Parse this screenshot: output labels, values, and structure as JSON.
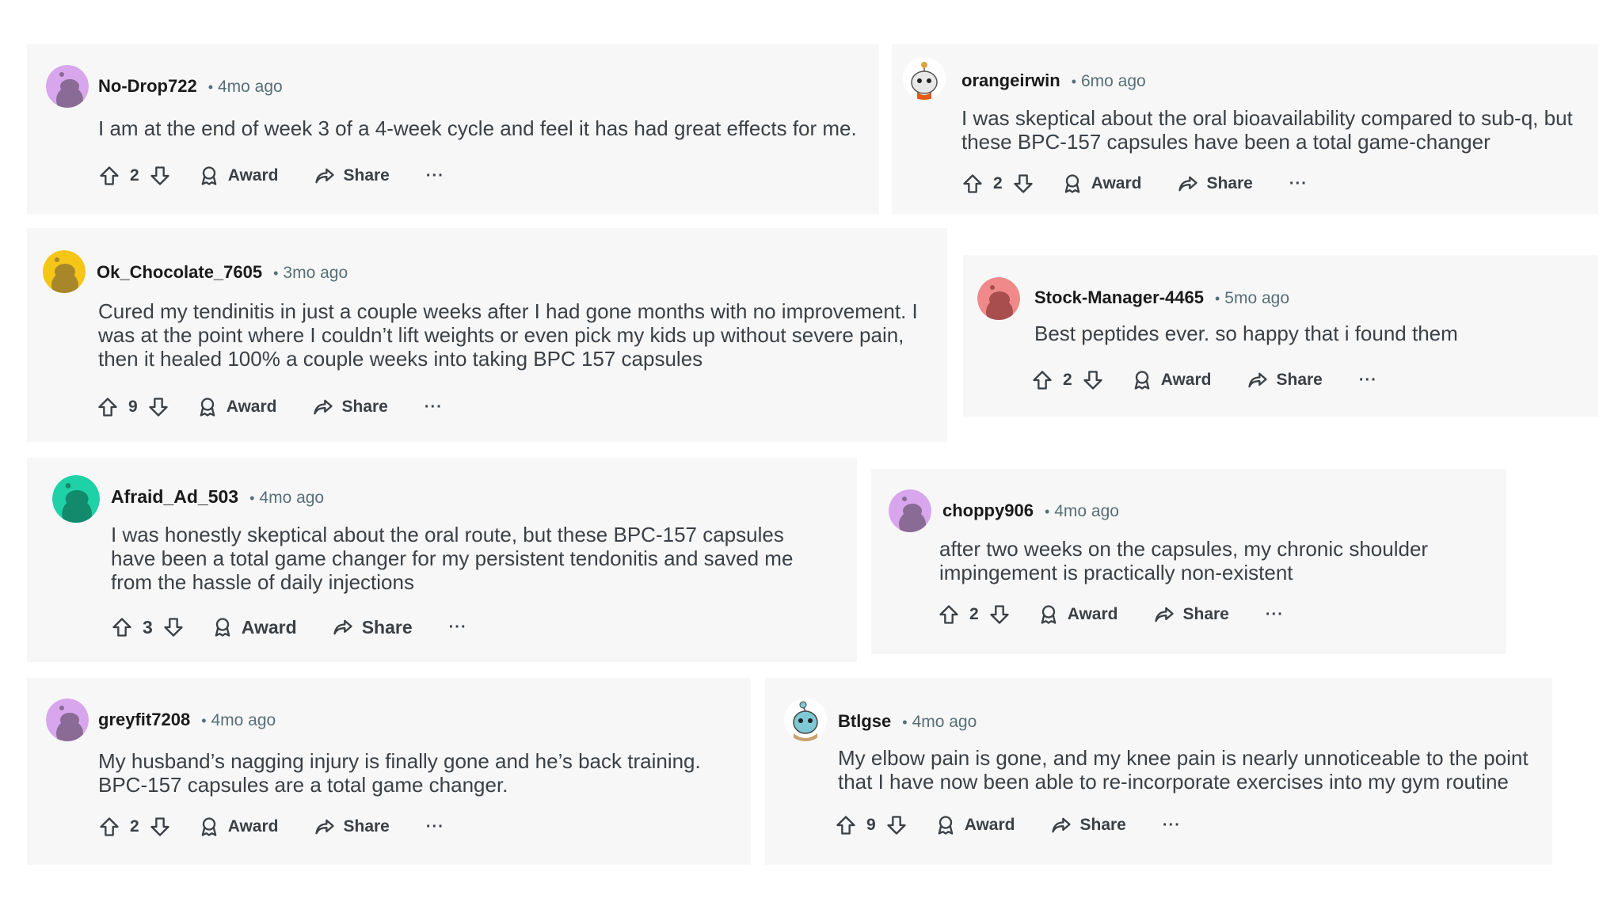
{
  "actions": {
    "award_label": "Award",
    "share_label": "Share",
    "more_label": "···"
  },
  "comments": [
    {
      "user": "No-Drop722",
      "time": "4mo ago",
      "text": "I am at the end of week 3 of a 4-week cycle and feel it has had great effects for me.",
      "votes": "2",
      "avatar_color": "#d8a6ec"
    },
    {
      "user": "orangeirwin",
      "time": "6mo ago",
      "text": "I was skeptical about the oral bioavailability compared to sub-q, but these BPC-157 capsules have been a total game-changer",
      "votes": "2",
      "avatar_color": "#ffffff"
    },
    {
      "user": "Ok_Chocolate_7605",
      "time": "3mo ago",
      "text": "Cured my tendinitis in just a couple weeks after I had gone months with no improvement. I was at the point where I couldn’t lift weights or even pick my kids up without severe pain, then it healed 100% a couple weeks into taking BPC 157 capsules",
      "votes": "9",
      "avatar_color": "#f5c518"
    },
    {
      "user": "Stock-Manager-4465",
      "time": "5mo ago",
      "text": "Best peptides ever. so happy that i found them",
      "votes": "2",
      "avatar_color": "#f08a8a"
    },
    {
      "user": "Afraid_Ad_503",
      "time": "4mo ago",
      "text": "I was honestly skeptical about the oral route, but these BPC-157 capsules have been a total game changer for my persistent tendonitis and saved me from the hassle of daily injections",
      "votes": "3",
      "avatar_color": "#1fd1a6"
    },
    {
      "user": "choppy906",
      "time": "4mo ago",
      "text": "after two weeks on the capsules, my chronic shoulder impingement is practically non-existent",
      "votes": "2",
      "avatar_color": "#d8a6ec"
    },
    {
      "user": "greyfit7208",
      "time": "4mo ago",
      "text": "My husband’s nagging injury is finally gone and he’s back training. BPC-157 capsules are a total game changer.",
      "votes": "2",
      "avatar_color": "#d8a6ec"
    },
    {
      "user": "Btlgse",
      "time": "4mo ago",
      "text": "My elbow pain is gone, and my knee pain is nearly unnoticeable to the point that I have now been able to re-incorporate exercises into my gym routine",
      "votes": "9",
      "avatar_color": "#ffffff"
    }
  ]
}
